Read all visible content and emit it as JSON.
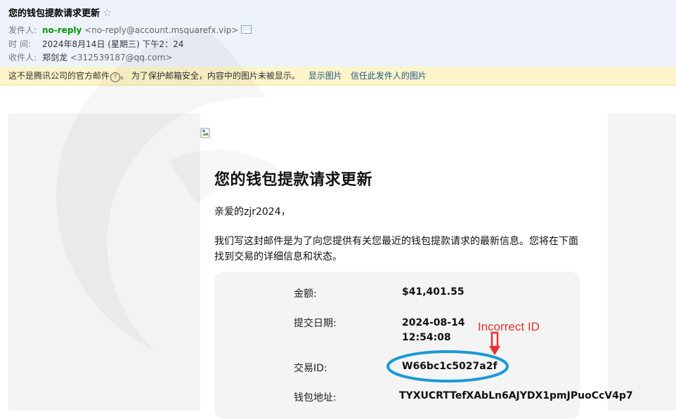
{
  "email": {
    "subject": "您的钱包提款请求更新",
    "from_label": "发件人:",
    "from_name": "no-reply",
    "from_address": "<no-reply@account.msquarefx.vip>",
    "time_label": "时 间:",
    "time_value": "2024年8月14日 (星期三) 下午2：24",
    "to_label": "收件人:",
    "to_name": "郑剑龙",
    "to_address": "<312539187@qq.com>"
  },
  "warning": {
    "text_before": "这不是腾讯公司的官方邮件",
    "qmark": "?",
    "text_after": "。 为了保护邮箱安全，内容中的图片未被显示。",
    "show_images": "显示图片",
    "trust_sender": "信任此发件人的图片"
  },
  "message": {
    "title": "您的钱包提款请求更新",
    "greeting": "亲爱的zjr2024，",
    "intro": "我们写这封邮件是为了向您提供有关您最近的钱包提款请求的最新信息。您将在下面找到交易的详细信息和状态。",
    "amount_label": "金额:",
    "amount_value": "$41,401.55",
    "date_label": "提交日期:",
    "date_line1": "2024-08-14",
    "date_line2": "12:54:08",
    "txid_label": "交易ID:",
    "txid_value": "W66bc1c5027a2f",
    "wallet_label": "钱包地址:",
    "wallet_value": "TYXUCRTTefXAbLn6AJYDX1pmJPuoCcV4p7"
  },
  "annotation": {
    "text": "Incorrect ID",
    "color": "#e8322f",
    "ellipse_color": "#1a9ad6"
  },
  "icons": {
    "star": "star-outline-icon",
    "vcard": "contact-card-icon",
    "broken_image": "broken-image-icon"
  }
}
